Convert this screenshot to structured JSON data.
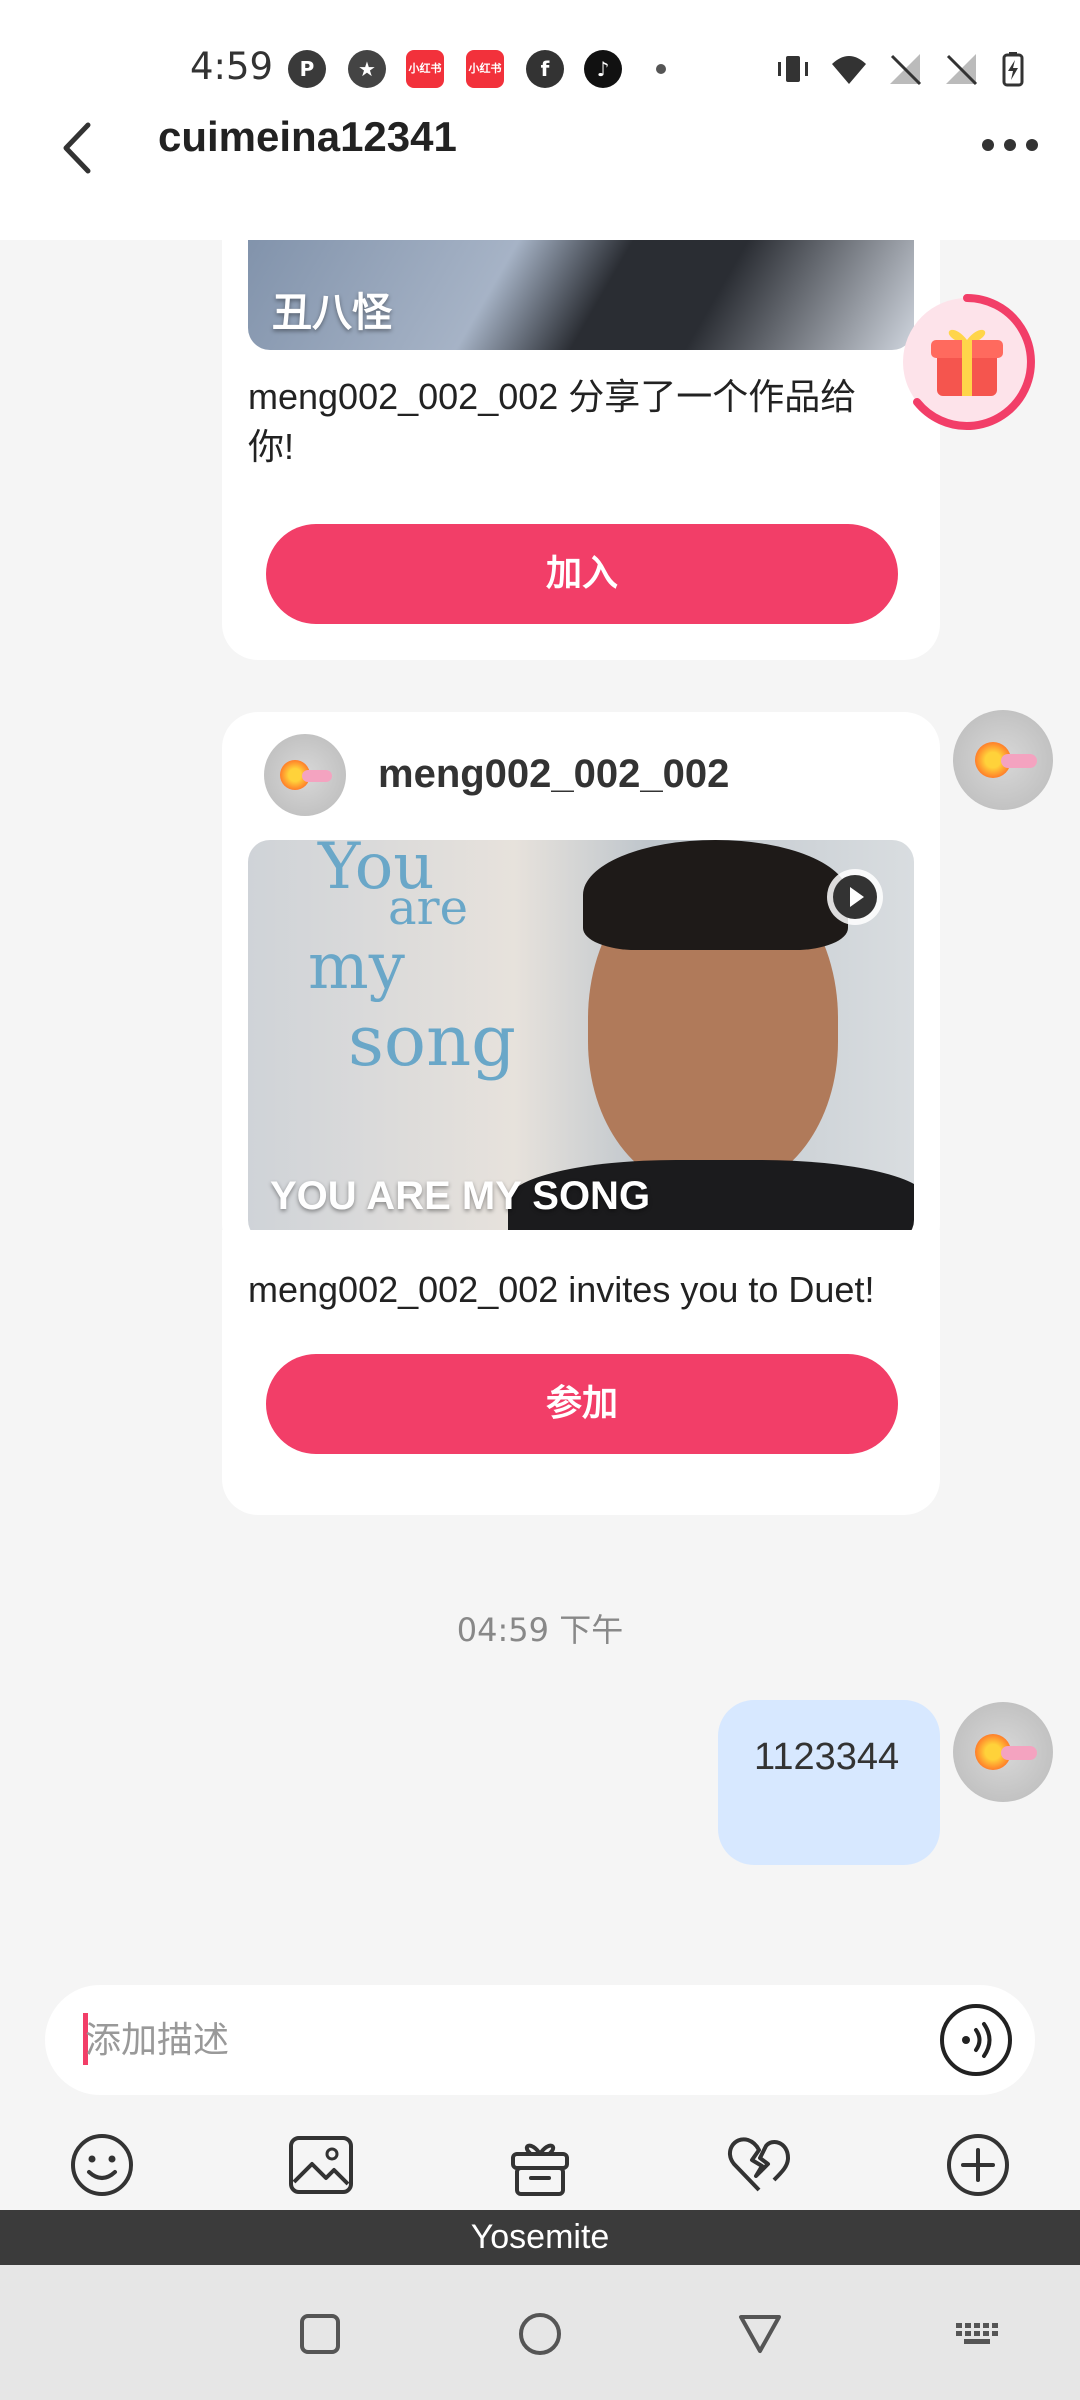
{
  "status_bar": {
    "time": "4:59",
    "app_icons": [
      "p-icon",
      "star-badge-icon",
      "xiaohongshu-icon",
      "xiaohongshu-icon",
      "facebook-icon",
      "tiktok-icon"
    ],
    "xiaohongshu_label": "小红书"
  },
  "header": {
    "title": "cuimeina12341"
  },
  "messages": {
    "card1": {
      "caption": "丑八怪",
      "text": "meng002_002_002 分享了一个作品给你!",
      "button": "加入"
    },
    "card2": {
      "username": "meng002_002_002",
      "caption": "YOU ARE MY SONG",
      "image_words": [
        "You",
        "are",
        "my",
        "song"
      ],
      "text": "meng002_002_002 invites you to Duet!",
      "button": "参加"
    },
    "timestamp": "04:59 下午",
    "sent": {
      "text": "1123344"
    }
  },
  "input": {
    "placeholder": "添加描述"
  },
  "toolbar": {
    "items": [
      "emoji-icon",
      "image-icon",
      "gift-icon",
      "broken-heart-icon",
      "plus-icon"
    ]
  },
  "keyboard": {
    "name": "Yosemite"
  },
  "colors": {
    "accent": "#f23e68",
    "sent_bubble": "#d7e8ff",
    "background": "#f5f5f5"
  }
}
